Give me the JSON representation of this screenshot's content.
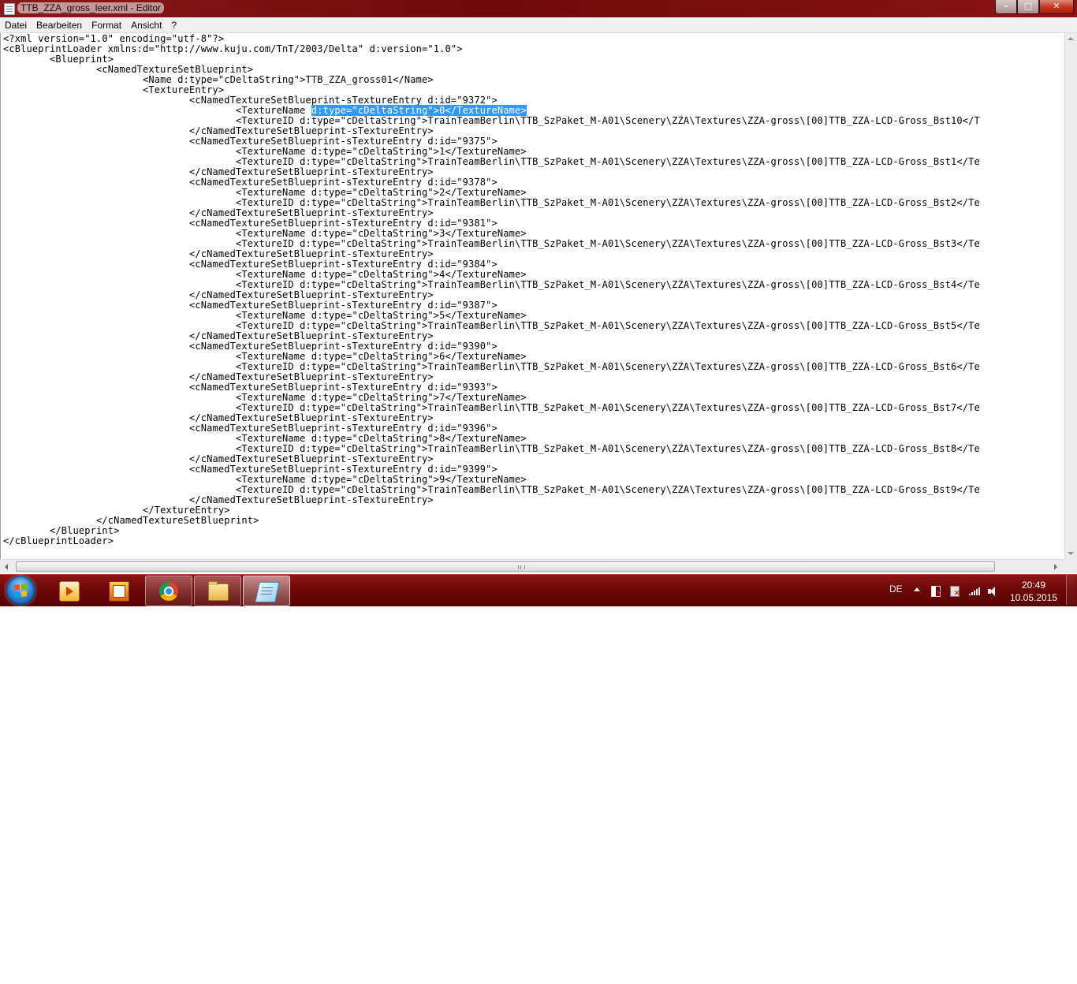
{
  "window": {
    "title": "TTB_ZZA_gross_leer.xml - Editor",
    "app_icon": "notepad-icon",
    "controls": {
      "minimize": "–",
      "maximize": "□",
      "close": "✕"
    }
  },
  "menu": [
    "Datei",
    "Bearbeiten",
    "Format",
    "Ansicht",
    "?"
  ],
  "editor": {
    "lines": [
      "<?xml version=\"1.0\" encoding=\"utf-8\"?>",
      "<cBlueprintLoader xmlns:d=\"http://www.kuju.com/TnT/2003/Delta\" d:version=\"1.0\">",
      "        <Blueprint>",
      "                <cNamedTextureSetBlueprint>",
      "                        <Name d:type=\"cDeltaString\">TTB_ZZA_gross01</Name>",
      "                        <TextureEntry>",
      "                                <cNamedTextureSetBlueprint-sTextureEntry d:id=\"9372\">",
      "                                        <TextureName ",
      "                                        <TextureID d:type=\"cDeltaString\">TrainTeamBerlin\\TTB_SzPaket_M-A01\\Scenery\\ZZA\\Textures\\ZZA-gross\\[00]TTB_ZZA-LCD-Gross_Bst10</T",
      "                                </cNamedTextureSetBlueprint-sTextureEntry>",
      "                                <cNamedTextureSetBlueprint-sTextureEntry d:id=\"9375\">",
      "                                        <TextureName d:type=\"cDeltaString\">1</TextureName>",
      "                                        <TextureID d:type=\"cDeltaString\">TrainTeamBerlin\\TTB_SzPaket_M-A01\\Scenery\\ZZA\\Textures\\ZZA-gross\\[00]TTB_ZZA-LCD-Gross_Bst1</Te",
      "                                </cNamedTextureSetBlueprint-sTextureEntry>",
      "                                <cNamedTextureSetBlueprint-sTextureEntry d:id=\"9378\">",
      "                                        <TextureName d:type=\"cDeltaString\">2</TextureName>",
      "                                        <TextureID d:type=\"cDeltaString\">TrainTeamBerlin\\TTB_SzPaket_M-A01\\Scenery\\ZZA\\Textures\\ZZA-gross\\[00]TTB_ZZA-LCD-Gross_Bst2</Te",
      "                                </cNamedTextureSetBlueprint-sTextureEntry>",
      "                                <cNamedTextureSetBlueprint-sTextureEntry d:id=\"9381\">",
      "                                        <TextureName d:type=\"cDeltaString\">3</TextureName>",
      "                                        <TextureID d:type=\"cDeltaString\">TrainTeamBerlin\\TTB_SzPaket_M-A01\\Scenery\\ZZA\\Textures\\ZZA-gross\\[00]TTB_ZZA-LCD-Gross_Bst3</Te",
      "                                </cNamedTextureSetBlueprint-sTextureEntry>",
      "                                <cNamedTextureSetBlueprint-sTextureEntry d:id=\"9384\">",
      "                                        <TextureName d:type=\"cDeltaString\">4</TextureName>",
      "                                        <TextureID d:type=\"cDeltaString\">TrainTeamBerlin\\TTB_SzPaket_M-A01\\Scenery\\ZZA\\Textures\\ZZA-gross\\[00]TTB_ZZA-LCD-Gross_Bst4</Te",
      "                                </cNamedTextureSetBlueprint-sTextureEntry>",
      "                                <cNamedTextureSetBlueprint-sTextureEntry d:id=\"9387\">",
      "                                        <TextureName d:type=\"cDeltaString\">5</TextureName>",
      "                                        <TextureID d:type=\"cDeltaString\">TrainTeamBerlin\\TTB_SzPaket_M-A01\\Scenery\\ZZA\\Textures\\ZZA-gross\\[00]TTB_ZZA-LCD-Gross_Bst5</Te",
      "                                </cNamedTextureSetBlueprint-sTextureEntry>",
      "                                <cNamedTextureSetBlueprint-sTextureEntry d:id=\"9390\">",
      "                                        <TextureName d:type=\"cDeltaString\">6</TextureName>",
      "                                        <TextureID d:type=\"cDeltaString\">TrainTeamBerlin\\TTB_SzPaket_M-A01\\Scenery\\ZZA\\Textures\\ZZA-gross\\[00]TTB_ZZA-LCD-Gross_Bst6</Te",
      "                                </cNamedTextureSetBlueprint-sTextureEntry>",
      "                                <cNamedTextureSetBlueprint-sTextureEntry d:id=\"9393\">",
      "                                        <TextureName d:type=\"cDeltaString\">7</TextureName>",
      "                                        <TextureID d:type=\"cDeltaString\">TrainTeamBerlin\\TTB_SzPaket_M-A01\\Scenery\\ZZA\\Textures\\ZZA-gross\\[00]TTB_ZZA-LCD-Gross_Bst7</Te",
      "                                </cNamedTextureSetBlueprint-sTextureEntry>",
      "                                <cNamedTextureSetBlueprint-sTextureEntry d:id=\"9396\">",
      "                                        <TextureName d:type=\"cDeltaString\">8</TextureName>",
      "                                        <TextureID d:type=\"cDeltaString\">TrainTeamBerlin\\TTB_SzPaket_M-A01\\Scenery\\ZZA\\Textures\\ZZA-gross\\[00]TTB_ZZA-LCD-Gross_Bst8</Te",
      "                                </cNamedTextureSetBlueprint-sTextureEntry>",
      "                                <cNamedTextureSetBlueprint-sTextureEntry d:id=\"9399\">",
      "                                        <TextureName d:type=\"cDeltaString\">9</TextureName>",
      "                                        <TextureID d:type=\"cDeltaString\">TrainTeamBerlin\\TTB_SzPaket_M-A01\\Scenery\\ZZA\\Textures\\ZZA-gross\\[00]TTB_ZZA-LCD-Gross_Bst9</Te",
      "                                </cNamedTextureSetBlueprint-sTextureEntry>",
      "                        </TextureEntry>",
      "                </cNamedTextureSetBlueprint>",
      "        </Blueprint>",
      "</cBlueprintLoader>"
    ],
    "selection": {
      "line": 7,
      "text": "d:type=\"cDeltaString\">0</TextureName>"
    },
    "selection_color": "#3399ff"
  },
  "taskbar": {
    "start_icon": "windows-start-orb",
    "items": [
      {
        "icon": "media-player-icon",
        "state": "pinned"
      },
      {
        "icon": "application-icon",
        "state": "pinned"
      },
      {
        "icon": "chrome-icon",
        "state": "running"
      },
      {
        "icon": "folder-icon",
        "state": "running"
      },
      {
        "icon": "notepad-icon",
        "state": "active"
      }
    ],
    "tray": {
      "language": "DE",
      "icons": [
        "show-hidden-icons-chevron",
        "action-center-flag-icon",
        "removable-drive-icon",
        "network-signal-icon",
        "volume-icon"
      ],
      "time": "20:49",
      "date": "10.05.2015"
    },
    "color": "#6e0a0a"
  }
}
